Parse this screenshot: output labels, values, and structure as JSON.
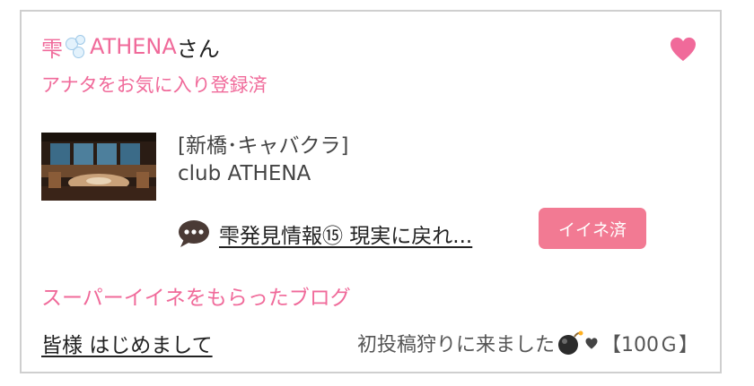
{
  "user": {
    "name_prefix": "雫",
    "name_main": "ATHENA",
    "name_suffix": "さん",
    "favorite_status": "アナタをお気に入り登録済",
    "heart_icon": "heart-icon",
    "bubbles_icon": "soap-bubbles-icon"
  },
  "shop": {
    "category": "[新橋･キャバクラ]",
    "name": "club ATHENA",
    "thumbnail_icon": "club-interior-photo"
  },
  "blog": {
    "icon": "speech-bubble-icon",
    "title": "雫発見情報⑮ 現実に戻れ...",
    "iine_label": "イイネ済"
  },
  "super_like": {
    "section_title": "スーパーイイネをもらったブログ",
    "post_title": "皆様 はじめまして",
    "post_comment_prefix": "初投稿狩りに来ました",
    "post_comment_suffix": "【100Ｇ】",
    "bomb_icon": "bomb-icon",
    "small_heart_icon": "small-heart-icon"
  },
  "colors": {
    "accent_pink": "#f06a9a",
    "button_pink": "#f27a93",
    "border": "#cfcfcf"
  }
}
